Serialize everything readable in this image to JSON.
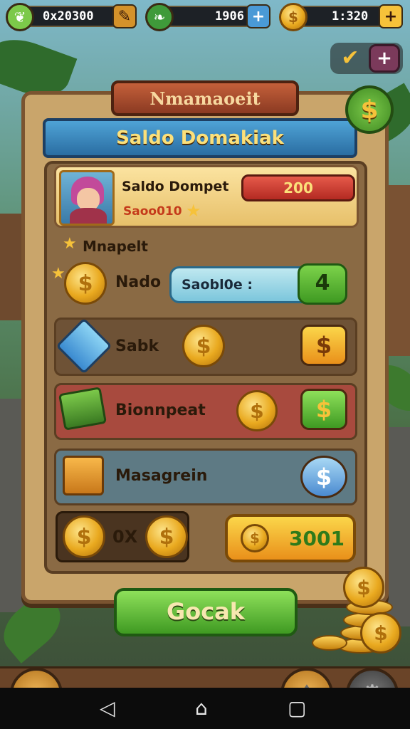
{
  "hud": {
    "left_value": "0x20300",
    "middle_value": "1906",
    "right_value": "1:320",
    "plus_symbol": "+",
    "dollar_symbol": "$"
  },
  "panel": {
    "plate_title": "Nmamaoeit",
    "banner_title": "Saldo Domakiak"
  },
  "profile": {
    "name": "Saldo Dompet",
    "subtitle": "Saoo010",
    "balance": "200"
  },
  "section": {
    "label": "Mnapelt"
  },
  "rows": [
    {
      "label": "Nado",
      "field_text": "Saobl0e :",
      "button": "4"
    },
    {
      "label": "Sabk",
      "button": "$"
    },
    {
      "label": "Bionnpeat",
      "button": "$"
    },
    {
      "label": "Masagrein",
      "button": "$"
    }
  ],
  "summary": {
    "multiplier": "0X",
    "total": "3001"
  },
  "main_button": "Gocak",
  "colors": {
    "accent_green": "#3f9a22",
    "accent_gold": "#e9a91f",
    "accent_blue": "#2a6da2",
    "accent_red": "#b32a22"
  },
  "icons": {
    "top_left": "leaf-icon",
    "top_middle": "leaf-icon",
    "top_right": "coin-icon",
    "home": "house-icon",
    "shovel": "shovel-icon",
    "settings": "gear-icon"
  }
}
